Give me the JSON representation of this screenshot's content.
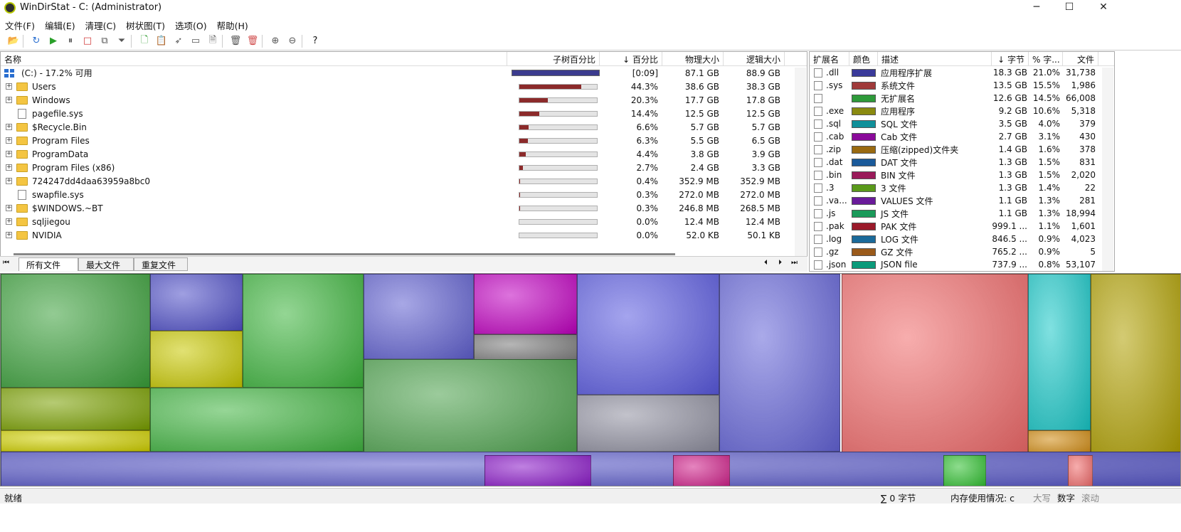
{
  "window": {
    "title": "WinDirStat - C:  (Administrator)",
    "minimize": "─",
    "maximize": "☐",
    "close": "✕"
  },
  "menu": [
    "文件(F)",
    "编辑(E)",
    "清理(C)",
    "树状图(T)",
    "选项(O)",
    "帮助(H)"
  ],
  "toolbar": {
    "help_label": "?"
  },
  "tree": {
    "headers": {
      "name": "名称",
      "subtree": "子树百分比",
      "percent": "↓ 百分比",
      "physical": "物理大小",
      "logical": "逻辑大小"
    },
    "root": {
      "name": "(C:) - 17.2% 可用",
      "percent": "[0:09]",
      "physical": "87.1 GB",
      "logical": "88.9 GB"
    },
    "rows": [
      {
        "name": "Users",
        "type": "folder",
        "fill": 0.443,
        "percent": "44.3%",
        "physical": "38.6 GB",
        "logical": "38.3 GB"
      },
      {
        "name": "Windows",
        "type": "folder",
        "fill": 0.203,
        "percent": "20.3%",
        "physical": "17.7 GB",
        "logical": "17.8 GB"
      },
      {
        "name": "pagefile.sys",
        "type": "file",
        "fill": 0.144,
        "percent": "14.4%",
        "physical": "12.5 GB",
        "logical": "12.5 GB"
      },
      {
        "name": "$Recycle.Bin",
        "type": "folder",
        "fill": 0.066,
        "percent": "6.6%",
        "physical": "5.7 GB",
        "logical": "5.7 GB"
      },
      {
        "name": "Program Files",
        "type": "folder",
        "fill": 0.063,
        "percent": "6.3%",
        "physical": "5.5 GB",
        "logical": "6.5 GB"
      },
      {
        "name": "ProgramData",
        "type": "folder",
        "fill": 0.044,
        "percent": "4.4%",
        "physical": "3.8 GB",
        "logical": "3.9 GB"
      },
      {
        "name": "Program Files (x86)",
        "type": "folder",
        "fill": 0.027,
        "percent": "2.7%",
        "physical": "2.4 GB",
        "logical": "3.3 GB"
      },
      {
        "name": "724247dd4daa63959a8bc0",
        "type": "folder",
        "fill": 0.004,
        "percent": "0.4%",
        "physical": "352.9 MB",
        "logical": "352.9 MB"
      },
      {
        "name": "swapfile.sys",
        "type": "file",
        "fill": 0.003,
        "percent": "0.3%",
        "physical": "272.0 MB",
        "logical": "272.0 MB"
      },
      {
        "name": "$WINDOWS.~BT",
        "type": "folder",
        "fill": 0.003,
        "percent": "0.3%",
        "physical": "246.8 MB",
        "logical": "268.5 MB"
      },
      {
        "name": "sqljiegou",
        "type": "folder",
        "fill": 0.0,
        "percent": "0.0%",
        "physical": "12.4 MB",
        "logical": "12.4 MB"
      },
      {
        "name": "NVIDIA",
        "type": "folder",
        "fill": 0.0,
        "percent": "0.0%",
        "physical": "52.0 KB",
        "logical": "50.1 KB"
      }
    ]
  },
  "tabs": [
    "所有文件",
    "最大文件",
    "重复文件"
  ],
  "extensions": {
    "headers": {
      "ext": "扩展名",
      "color": "颜色",
      "desc": "描述",
      "bytes": "↓ 字节",
      "pct": "% 字...",
      "files": "文件"
    },
    "rows": [
      {
        "ext": ".dll",
        "color": "#3a3a9a",
        "desc": "应用程序扩展",
        "bytes": "18.3 GB",
        "pct": "21.0%",
        "files": "31,738"
      },
      {
        "ext": ".sys",
        "color": "#a03a3a",
        "desc": "系统文件",
        "bytes": "13.5 GB",
        "pct": "15.5%",
        "files": "1,986"
      },
      {
        "ext": "",
        "color": "#2e9a3a",
        "desc": "无扩展名",
        "bytes": "12.6 GB",
        "pct": "14.5%",
        "files": "66,008"
      },
      {
        "ext": ".exe",
        "color": "#8a8a10",
        "desc": "应用程序",
        "bytes": "9.2 GB",
        "pct": "10.6%",
        "files": "5,318"
      },
      {
        "ext": ".sql",
        "color": "#10909a",
        "desc": "SQL 文件",
        "bytes": "3.5 GB",
        "pct": "4.0%",
        "files": "379"
      },
      {
        "ext": ".cab",
        "color": "#8a0a9a",
        "desc": "Cab 文件",
        "bytes": "2.7 GB",
        "pct": "3.1%",
        "files": "430"
      },
      {
        "ext": ".zip",
        "color": "#9a6a10",
        "desc": "压缩(zipped)文件夹",
        "bytes": "1.4 GB",
        "pct": "1.6%",
        "files": "378"
      },
      {
        "ext": ".dat",
        "color": "#1a5a9a",
        "desc": "DAT 文件",
        "bytes": "1.3 GB",
        "pct": "1.5%",
        "files": "831"
      },
      {
        "ext": ".bin",
        "color": "#9a1a5a",
        "desc": "BIN 文件",
        "bytes": "1.3 GB",
        "pct": "1.5%",
        "files": "2,020"
      },
      {
        "ext": ".3",
        "color": "#5a9a1a",
        "desc": "3 文件",
        "bytes": "1.3 GB",
        "pct": "1.4%",
        "files": "22"
      },
      {
        "ext": ".va...",
        "color": "#6a1a9a",
        "desc": "VALUES 文件",
        "bytes": "1.1 GB",
        "pct": "1.3%",
        "files": "281"
      },
      {
        "ext": ".js",
        "color": "#1a9a5a",
        "desc": "JS 文件",
        "bytes": "1.1 GB",
        "pct": "1.3%",
        "files": "18,994"
      },
      {
        "ext": ".pak",
        "color": "#9a1a2a",
        "desc": "PAK 文件",
        "bytes": "999.1 ...",
        "pct": "1.1%",
        "files": "1,601"
      },
      {
        "ext": ".log",
        "color": "#1a6a9a",
        "desc": "LOG 文件",
        "bytes": "846.5 ...",
        "pct": "0.9%",
        "files": "4,023"
      },
      {
        "ext": ".gz",
        "color": "#9a5a1a",
        "desc": "GZ 文件",
        "bytes": "765.2 ...",
        "pct": "0.9%",
        "files": "5"
      },
      {
        "ext": ".json",
        "color": "#0a9a7a",
        "desc": "JSON file",
        "bytes": "737.9 ...",
        "pct": "0.8%",
        "files": "53,107"
      }
    ]
  },
  "status": {
    "ready": "就绪",
    "sum": "∑ 0 字节",
    "memory": "内存使用情况: c",
    "caps": "大写",
    "num": "数字",
    "scroll": "滚动"
  }
}
